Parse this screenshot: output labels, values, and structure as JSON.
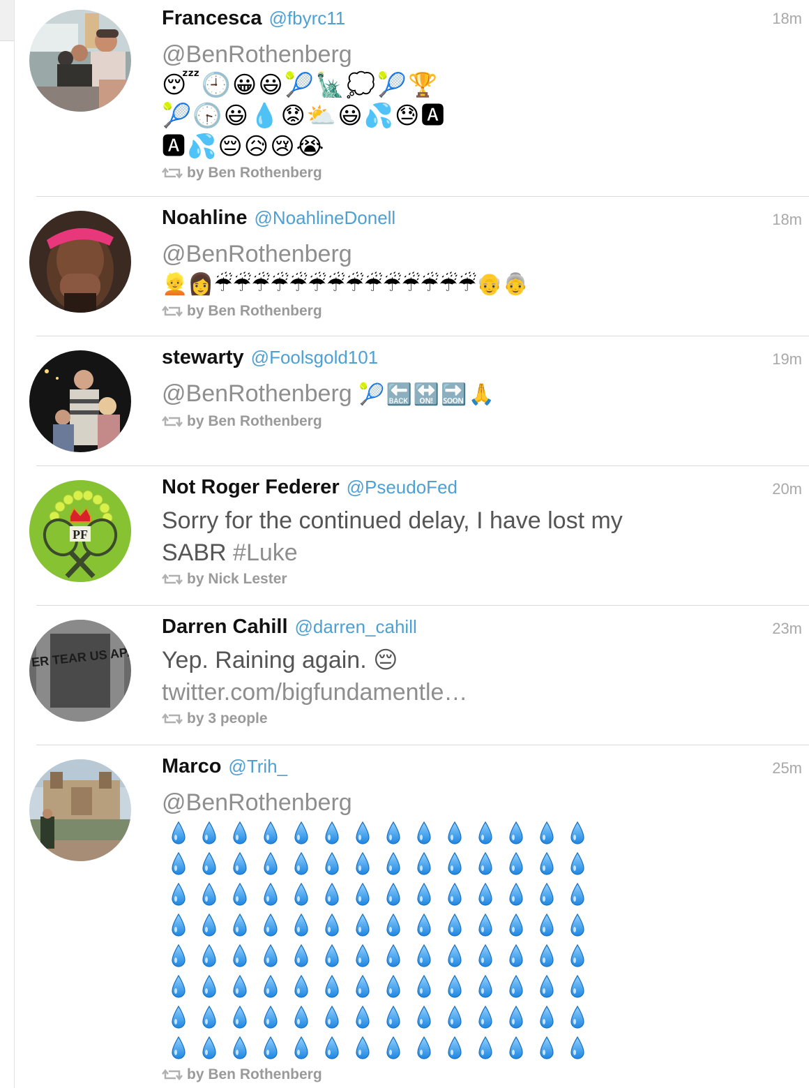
{
  "colors": {
    "handle": "#4ea0d4",
    "name": "#111111",
    "body_text": "#555555",
    "meta": "#9a9a9a",
    "divider": "#d9d9d9"
  },
  "tweets": [
    {
      "name": "Francesca",
      "handle": "@fbyrc11",
      "time": "18m",
      "mention": "@BenRothenberg",
      "emoji_lines": [
        "😴🕘😀😃🎾🗽💭🎾🏆",
        "🎾🕞😃💧😟⛅😃💦😓🅰",
        "🅰💦😔😥😢😭"
      ],
      "retweet": "by Ben Rothenberg",
      "avatar_icon": "photo-avatar-people-icon"
    },
    {
      "name": "Noahline",
      "handle": "@NoahlineDonell",
      "time": "18m",
      "mention": "@BenRothenberg",
      "emoji_lines": [
        "👱👩☔☔☔☔☔☔☔☔☔☔☔☔☔☔👴👵"
      ],
      "retweet": "by Ben Rothenberg",
      "avatar_icon": "photo-avatar-pink-visor-icon"
    },
    {
      "name": "stewarty",
      "handle": "@Foolsgold101",
      "time": "19m",
      "mention": "@BenRothenberg",
      "inline_emoji": "🎾🔙🔛🔜🙏",
      "retweet": "by Ben Rothenberg",
      "avatar_icon": "photo-avatar-group-night-icon"
    },
    {
      "name": "Not Roger Federer",
      "handle": "@PseudoFed",
      "time": "20m",
      "text": "Sorry for the continued delay, I have lost my",
      "text2": "SABR",
      "hashtag": "#Luke",
      "retweet": "by Nick Lester",
      "avatar_icon": "pf-crown-rackets-logo-icon",
      "avatar_text": "PF"
    },
    {
      "name": "Darren Cahill",
      "handle": "@darren_cahill",
      "time": "23m",
      "text": "Yep. Raining again. 😔",
      "link": "twitter.com/bigfundamentle…",
      "retweet": "by 3 people",
      "avatar_icon": "photo-avatar-never-tear-us-apart-shirt-icon",
      "avatar_text": "NEVER TEAR US APART"
    },
    {
      "name": "Marco",
      "handle": "@Trih_",
      "time": "25m",
      "mention": "@BenRothenberg",
      "drops_rows": 8,
      "drops_cols": 14,
      "retweet": "by Ben Rothenberg",
      "avatar_icon": "photo-avatar-monaco-casino-icon"
    }
  ]
}
